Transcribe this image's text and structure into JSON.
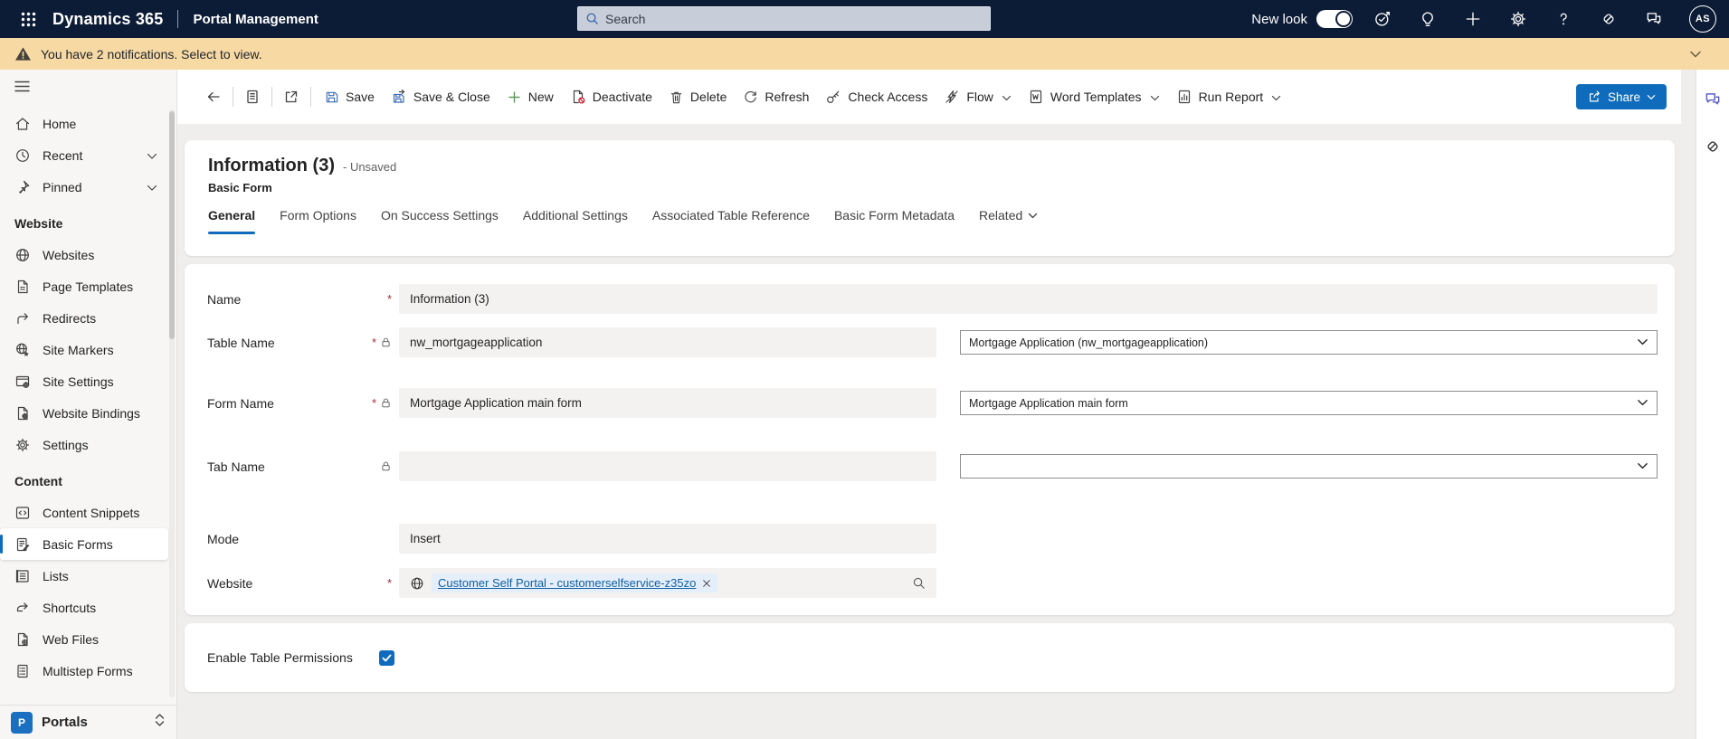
{
  "colors": {
    "accent": "#0f6cbd",
    "topbar_bg": "#0d1c36",
    "notification_bg": "#f7d9a4",
    "link": "#115ea3",
    "required_marker": "#ad2a36",
    "selected_nav_indicator": "#0f6cbd"
  },
  "topbar": {
    "waffle_icon": "waffle-icon",
    "brand": "Dynamics 365",
    "app_name": "Portal Management",
    "search": {
      "placeholder": "Search",
      "icon": "search-icon"
    },
    "new_look": {
      "label": "New look",
      "enabled": true
    },
    "action_icons": [
      "task-check-icon",
      "lightbulb-icon",
      "add-icon",
      "gear-icon",
      "help-icon",
      "copilot-icon",
      "feedback-icon"
    ],
    "avatar": {
      "initials": "AS"
    }
  },
  "notification_bar": {
    "icon": "warning-icon",
    "text": "You have 2 notifications. Select to view.",
    "collapse_icon": "chevron-down-icon"
  },
  "sidebar": {
    "menu_icon": "hamburger-icon",
    "top_items": [
      {
        "label": "Home",
        "icon": "home-icon"
      },
      {
        "label": "Recent",
        "icon": "clock-icon",
        "expand_icon": "chevron-down-icon"
      },
      {
        "label": "Pinned",
        "icon": "pin-icon",
        "expand_icon": "chevron-down-icon"
      }
    ],
    "website_section": {
      "header": "Website",
      "items": [
        {
          "label": "Websites",
          "icon": "globe-icon"
        },
        {
          "label": "Page Templates",
          "icon": "page-template-icon"
        },
        {
          "label": "Redirects",
          "icon": "redirect-icon"
        },
        {
          "label": "Site Markers",
          "icon": "site-marker-icon"
        },
        {
          "label": "Site Settings",
          "icon": "site-settings-icon"
        },
        {
          "label": "Website Bindings",
          "icon": "website-bindings-icon"
        },
        {
          "label": "Settings",
          "icon": "gear-icon"
        }
      ]
    },
    "content_section": {
      "header": "Content",
      "items": [
        {
          "label": "Content Snippets",
          "icon": "code-snippet-icon"
        },
        {
          "label": "Basic Forms",
          "icon": "form-edit-icon",
          "selected": true
        },
        {
          "label": "Lists",
          "icon": "list-icon"
        },
        {
          "label": "Shortcuts",
          "icon": "shortcut-icon"
        },
        {
          "label": "Web Files",
          "icon": "web-file-icon"
        },
        {
          "label": "Multistep Forms",
          "icon": "multistep-form-icon"
        }
      ]
    },
    "footer": {
      "initial": "P",
      "label": "Portals",
      "switch_icon": "chevron-up-down-icon"
    }
  },
  "command_bar": {
    "back_icon": "back-arrow-icon",
    "form_switcher_icon": "form-switcher-icon",
    "popout_icon": "popout-icon",
    "save": "Save",
    "save_and_close": "Save & Close",
    "new": "New",
    "deactivate": "Deactivate",
    "delete": "Delete",
    "refresh": "Refresh",
    "check_access": "Check Access",
    "flow": "Flow",
    "word_templates": "Word Templates",
    "run_report": "Run Report",
    "share": "Share"
  },
  "record": {
    "title": "Information (3)",
    "status": "- Unsaved",
    "entity_type": "Basic Form"
  },
  "tabs": [
    {
      "label": "General",
      "active": true
    },
    {
      "label": "Form Options"
    },
    {
      "label": "On Success Settings"
    },
    {
      "label": "Additional Settings"
    },
    {
      "label": "Associated Table Reference"
    },
    {
      "label": "Basic Form Metadata"
    },
    {
      "label": "Related",
      "has_dropdown": true
    }
  ],
  "form": {
    "fields": [
      {
        "label": "Name",
        "marker": "*",
        "locked": false,
        "value": "Information (3)"
      },
      {
        "label": "Table Name",
        "marker": "*",
        "locked": true,
        "value": "nw_mortgageapplication",
        "dropdown_value": "Mortgage Application (nw_mortgageapplication)"
      },
      {
        "label": "Form Name",
        "marker": "*",
        "locked": true,
        "value": "Mortgage Application main form",
        "dropdown_value": "Mortgage Application main form"
      },
      {
        "label": "Tab Name",
        "marker": "",
        "locked": true,
        "value": "",
        "dropdown_value": ""
      },
      {
        "label": "Mode",
        "marker": "",
        "locked": false,
        "value": "Insert"
      },
      {
        "label": "Website",
        "marker": "*",
        "locked": false,
        "lookup_value": "Customer Self Portal - customerselfservice-z35zo",
        "lookup_icon": "globe-icon",
        "remove_icon": "close-icon",
        "search_icon": "search-icon"
      }
    ],
    "table_permissions": {
      "label": "Enable Table Permissions",
      "checked": true
    }
  },
  "side_rail": {
    "icons": [
      "feedback-icon",
      "copilot-icon"
    ]
  }
}
